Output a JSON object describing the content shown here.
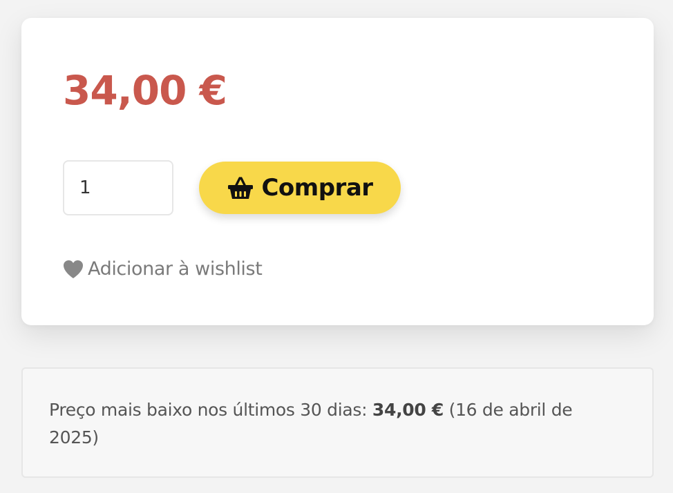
{
  "product": {
    "price": "34,00 €",
    "quantity": "1",
    "buy_button_label": "Comprar",
    "buy_button_icon": "basket-icon",
    "wishlist_label": "Adicionar à wishlist",
    "wishlist_icon": "heart-icon"
  },
  "lowest_price_note": {
    "prefix": "Preço mais baixo nos últimos 30 dias: ",
    "price": "34,00 €",
    "date": " (16 de abril de 2025)"
  },
  "colors": {
    "price": "#c9584d",
    "buy_button": "#f8d84a",
    "wishlist": "#7a7a7a",
    "icon_dark": "#111111",
    "icon_gray": "#888888"
  }
}
